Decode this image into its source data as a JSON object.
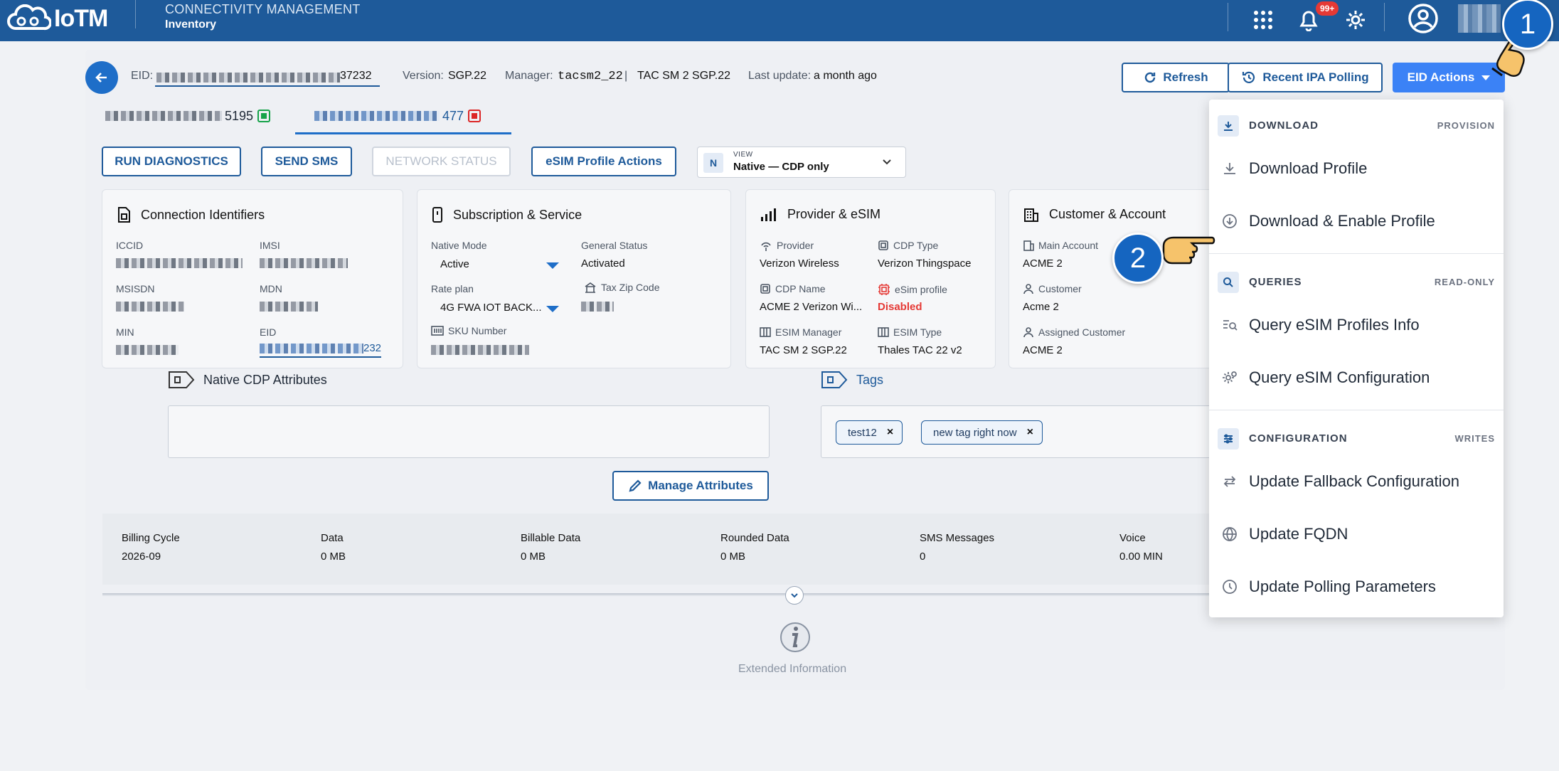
{
  "topbar": {
    "logo_text": "IoTM",
    "app_title": "CONNECTIVITY MANAGEMENT",
    "app_subtitle": "Inventory",
    "notification_badge": "99+",
    "icons": [
      "apps-grid-icon",
      "bell-icon",
      "gear-icon",
      "user-avatar-icon"
    ]
  },
  "steps": {
    "one": "1",
    "two": "2"
  },
  "header": {
    "eid_label": "EID:",
    "eid_suffix": "37232",
    "version_label": "Version:",
    "version_value": "SGP.22",
    "manager_label": "Manager:",
    "manager_value": "tacsm2_22",
    "manager_sep": "|",
    "manager_extra": "TAC SM 2 SGP.22",
    "update_label": "Last update:",
    "update_value": "a month ago",
    "refresh": "Refresh",
    "recent_polling": "Recent IPA Polling",
    "eid_actions": "EID Actions"
  },
  "tabs": [
    {
      "suffix": "5195",
      "status": "green"
    },
    {
      "suffix": "477",
      "status": "red"
    }
  ],
  "actions": {
    "run_diagnostics": "RUN DIAGNOSTICS",
    "send_sms": "SEND SMS",
    "network_status": "NETWORK STATUS",
    "esim_profile_actions": "eSIM Profile Actions"
  },
  "view": {
    "badge": "N",
    "label": "VIEW",
    "value": "Native — CDP only"
  },
  "cards": {
    "connection": {
      "title": "Connection Identifiers",
      "iccid": "ICCID",
      "imsi": "IMSI",
      "msisdn": "MSISDN",
      "mdn": "MDN",
      "min": "MIN",
      "eid": "EID",
      "eid_suffix": "232"
    },
    "subscription": {
      "title": "Subscription & Service",
      "native_mode_label": "Native Mode",
      "native_mode_value": "Active",
      "general_status_label": "General Status",
      "general_status_value": "Activated",
      "rate_plan_label": "Rate plan",
      "rate_plan_value": "4G FWA IOT BACK...",
      "tax_zip_label": "Tax Zip Code",
      "sku_label": "SKU Number"
    },
    "provider": {
      "title": "Provider & eSIM",
      "provider_label": "Provider",
      "provider_value": "Verizon Wireless",
      "cdp_type_label": "CDP Type",
      "cdp_type_value": "Verizon Thingspace",
      "cdp_name_label": "CDP Name",
      "cdp_name_value": "ACME 2 Verizon Wi...",
      "esim_profile_label": "eSim profile",
      "esim_profile_value": "Disabled",
      "esim_manager_label": "ESIM Manager",
      "esim_manager_value": "TAC SM 2 SGP.22",
      "esim_type_label": "ESIM Type",
      "esim_type_value": "Thales TAC 22 v2"
    },
    "customer": {
      "title": "Customer & Account",
      "main_account_label": "Main Account",
      "main_account_value": "ACME 2",
      "customer_label": "Customer",
      "customer_value": "Acme 2",
      "assigned_label": "Assigned Customer",
      "assigned_value": "ACME 2"
    }
  },
  "attributes": {
    "title": "Native CDP Attributes",
    "manage_button": "Manage Attributes"
  },
  "tags": {
    "title": "Tags",
    "items": [
      "test12",
      "new tag right now"
    ],
    "remove": "×"
  },
  "billing": {
    "headers": [
      "Billing Cycle",
      "Data",
      "Billable Data",
      "Rounded Data",
      "SMS Messages",
      "Voice"
    ],
    "values": [
      "2026-09",
      "0 MB",
      "0 MB",
      "0 MB",
      "0",
      "0.00 MIN"
    ]
  },
  "extended": {
    "label": "Extended Information"
  },
  "menu": {
    "sections": [
      {
        "name": "DOWNLOAD",
        "tag": "PROVISION",
        "icon": "download-icon"
      },
      {
        "name": "QUERIES",
        "tag": "READ-ONLY",
        "icon": "search-icon"
      },
      {
        "name": "CONFIGURATION",
        "tag": "WRITES",
        "icon": "sliders-icon"
      }
    ],
    "items": [
      {
        "label": "Download Profile",
        "icon": "download-icon"
      },
      {
        "label": "Download & Enable Profile",
        "icon": "download-circle-icon"
      },
      {
        "label": "Query eSIM Profiles Info",
        "icon": "list-search-icon"
      },
      {
        "label": "Query eSIM Configuration",
        "icon": "gear-search-icon"
      },
      {
        "label": "Update Fallback Configuration",
        "icon": "swap-arrows-icon"
      },
      {
        "label": "Update FQDN",
        "icon": "globe-icon"
      },
      {
        "label": "Update Polling Parameters",
        "icon": "clock-icon"
      }
    ]
  },
  "colors": {
    "brand": "#1e5a9a",
    "accent": "#3b82f6",
    "danger": "#e53935",
    "success": "#16a34a"
  }
}
